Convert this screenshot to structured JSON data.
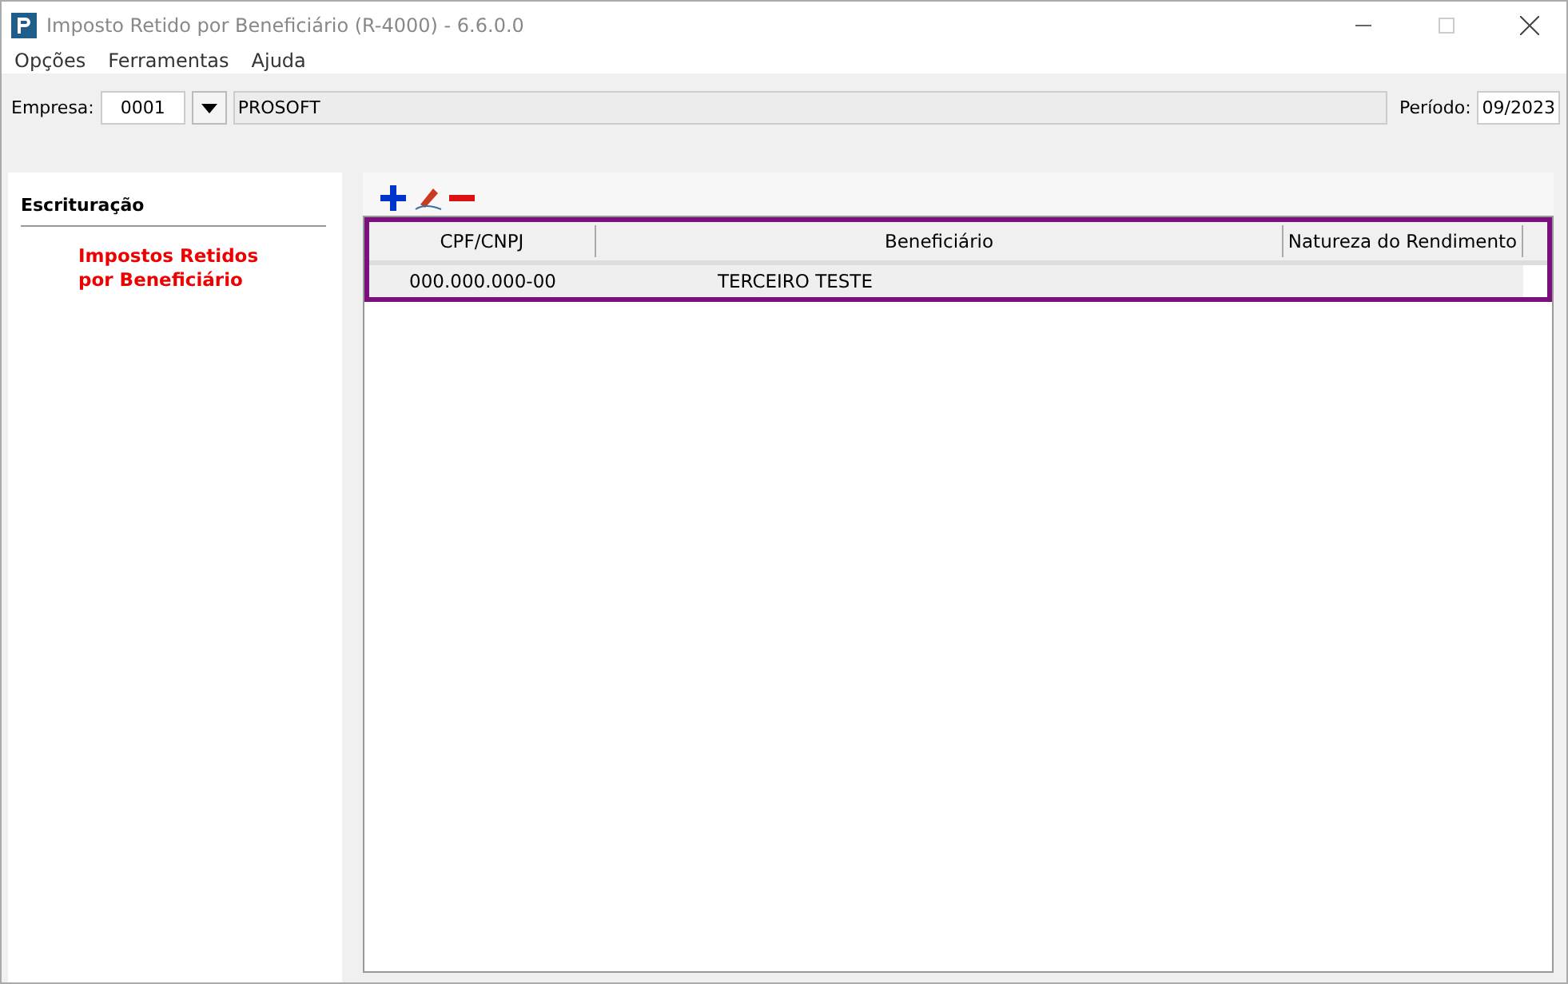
{
  "window": {
    "title": "Imposto Retido por Beneficiário (R-4000) - 6.6.0.0"
  },
  "menu": [
    "Opções",
    "Ferramentas",
    "Ajuda"
  ],
  "company": {
    "label": "Empresa:",
    "code": "0001",
    "name": "PROSOFT"
  },
  "period": {
    "label": "Período:",
    "value": "09/2023"
  },
  "sidebar": {
    "title": "Escrituração",
    "items": [
      {
        "label": "Impostos Retidos por Beneficiário",
        "selected": true
      }
    ]
  },
  "table": {
    "columns": [
      "CPF/CNPJ",
      "Beneficiário",
      "Natureza do Rendimento"
    ],
    "rows": [
      {
        "cells": [
          "000.000.000-00",
          "TERCEIRO TESTE",
          ""
        ],
        "selected": false
      }
    ]
  }
}
